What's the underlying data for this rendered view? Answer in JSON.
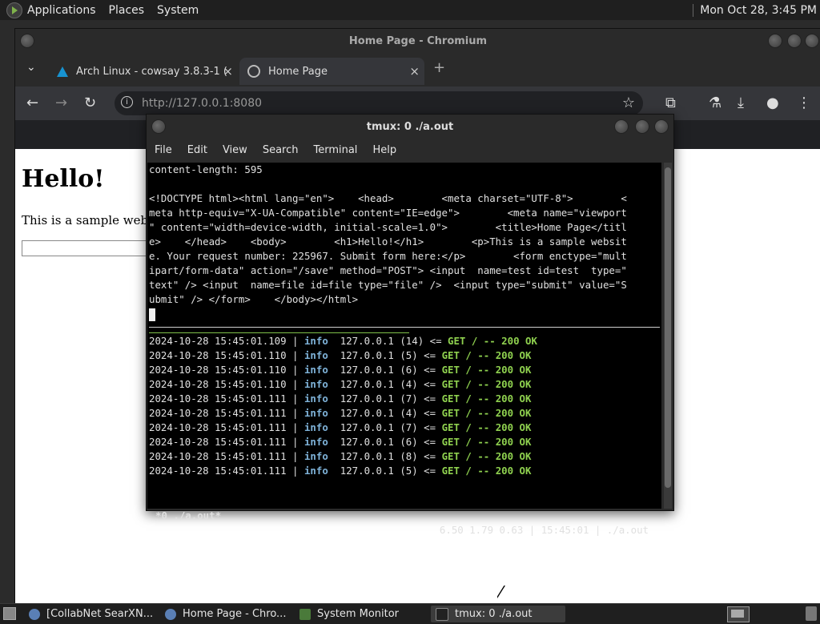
{
  "top_panel": {
    "applications": "Applications",
    "places": "Places",
    "system": "System",
    "clock": "Mon Oct 28,  3:45 PM"
  },
  "chromium": {
    "window_title": "Home Page - Chromium",
    "tabs": [
      {
        "label": "Arch Linux - cowsay 3.8.3-1 (",
        "close": "×"
      },
      {
        "label": "Home Page",
        "close": "×"
      }
    ],
    "new_tab": "+",
    "tab_search": "⌄",
    "url_host": "http://127.0.0.1",
    "url_port": ":8080",
    "page": {
      "heading": "Hello!",
      "paragraph": "This is a sample website"
    }
  },
  "terminal": {
    "window_title": "tmux: 0 ./a.out",
    "menu": [
      "File",
      "Edit",
      "View",
      "Search",
      "Terminal",
      "Help"
    ],
    "top_lines": [
      "content-length: 595",
      "",
      "<!DOCTYPE html><html lang=\"en\">    <head>        <meta charset=\"UTF-8\">        <",
      "meta http-equiv=\"X-UA-Compatible\" content=\"IE=edge\">        <meta name=\"viewport",
      "\" content=\"width=device-width, initial-scale=1.0\">        <title>Home Page</titl",
      "e>    </head>    <body>        <h1>Hello!</h1>        <p>This is a sample websit",
      "e. Your request number: 225967. Submit form here:</p>        <form enctype=\"mult",
      "ipart/form-data\" action=\"/save\" method=\"POST\"> <input  name=test id=test  type=\"",
      "text\" /> <input  name=file id=file type=\"file\" />  <input type=\"submit\" value=\"S",
      "ubmit\" /> </form>    </body></html>"
    ],
    "log": [
      {
        "ts": "2024-10-28 15:45:01.109",
        "level": "info",
        "addr": "127.0.0.1 (14) <= ",
        "req": "GET / -- 200 OK"
      },
      {
        "ts": "2024-10-28 15:45:01.110",
        "level": "info",
        "addr": "127.0.0.1 (5) <= ",
        "req": "GET / -- 200 OK"
      },
      {
        "ts": "2024-10-28 15:45:01.110",
        "level": "info",
        "addr": "127.0.0.1 (6) <= ",
        "req": "GET / -- 200 OK"
      },
      {
        "ts": "2024-10-28 15:45:01.110",
        "level": "info",
        "addr": "127.0.0.1 (4) <= ",
        "req": "GET / -- 200 OK"
      },
      {
        "ts": "2024-10-28 15:45:01.111",
        "level": "info",
        "addr": "127.0.0.1 (7) <= ",
        "req": "GET / -- 200 OK"
      },
      {
        "ts": "2024-10-28 15:45:01.111",
        "level": "info",
        "addr": "127.0.0.1 (4) <= ",
        "req": "GET / -- 200 OK"
      },
      {
        "ts": "2024-10-28 15:45:01.111",
        "level": "info",
        "addr": "127.0.0.1 (7) <= ",
        "req": "GET / -- 200 OK"
      },
      {
        "ts": "2024-10-28 15:45:01.111",
        "level": "info",
        "addr": "127.0.0.1 (6) <= ",
        "req": "GET / -- 200 OK"
      },
      {
        "ts": "2024-10-28 15:45:01.111",
        "level": "info",
        "addr": "127.0.0.1 (8) <= ",
        "req": "GET / -- 200 OK"
      },
      {
        "ts": "2024-10-28 15:45:01.111",
        "level": "info",
        "addr": "127.0.0.1 (5) <= ",
        "req": "GET / -- 200 OK"
      }
    ],
    "status_left": "*0 ./a.out*",
    "status_right": "6.50 1.79 0.63 | 15:45:01 | ./a.out"
  },
  "taskbar": {
    "items": [
      {
        "label": "[CollabNet SearXN...",
        "icon": "chromium-icon"
      },
      {
        "label": "Home Page - Chro...",
        "icon": "chromium-icon"
      },
      {
        "label": "System Monitor",
        "icon": "system-monitor-icon"
      },
      {
        "label": "tmux: 0 ./a.out",
        "icon": "terminal-icon"
      }
    ]
  },
  "colors": {
    "log_info": "#7fb3d9",
    "log_ok": "#8fd14f",
    "arch_blue": "#1793d1"
  }
}
